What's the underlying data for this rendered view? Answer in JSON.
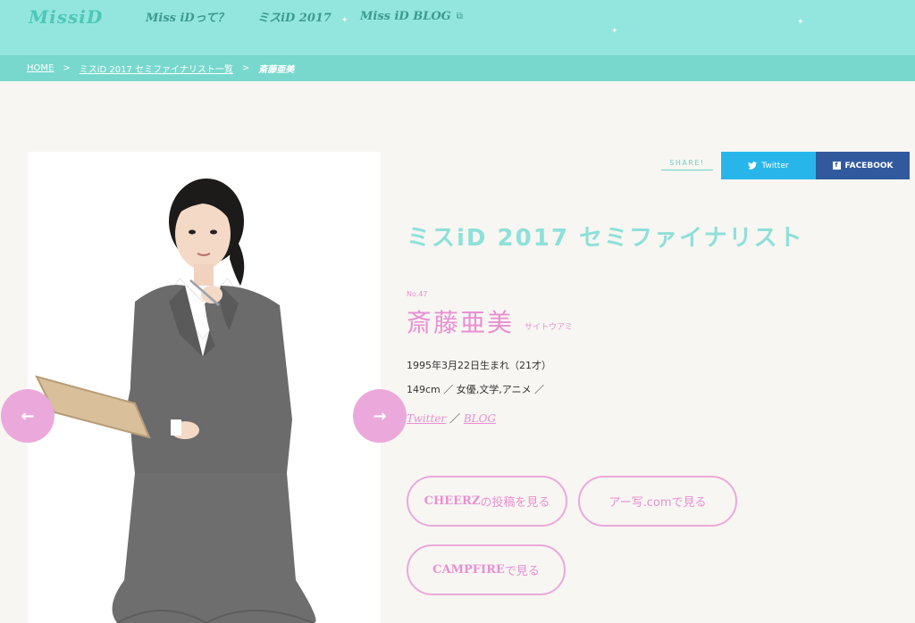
{
  "header": {
    "logo_text": "MissiD",
    "nav": [
      {
        "label": "Miss iDって？"
      },
      {
        "label": "ミスiD 2017"
      },
      {
        "label": "Miss iD BLOG",
        "icon": "external-link-icon"
      }
    ]
  },
  "breadcrumb": {
    "home": "HOME",
    "sep": ">",
    "list": "ミスiD 2017 セミファイナリスト一覧",
    "current": "斎藤亜美"
  },
  "share": {
    "label": "SHARE!",
    "twitter": "Twitter",
    "facebook": "FACEBOOK"
  },
  "profile": {
    "section_title": "ミスiD 2017 セミファイナリスト",
    "entry_no": "No.47",
    "name": "斎藤亜美",
    "kana": "サイトウアミ",
    "birth": "1995年3月22日生まれ（21才）",
    "details": "149cm ／ 女優,文学,アニメ ／",
    "links": {
      "twitter": "Twitter",
      "separator": "／",
      "blog": "BLOG"
    }
  },
  "buttons": {
    "cheerz": {
      "brand": "CHEERZ",
      "suffix": "の投稿を見る"
    },
    "aisha": "アー写.comで見る",
    "campfire": {
      "brand": "CAMPFIRE",
      "suffix": "で見る"
    }
  },
  "colors": {
    "header_bg": "#93e6de",
    "breadcrumb_bg": "#78d8cd",
    "accent_pink": "#e98fd2",
    "twitter_blue": "#28b6ea",
    "facebook_blue": "#31599e"
  }
}
